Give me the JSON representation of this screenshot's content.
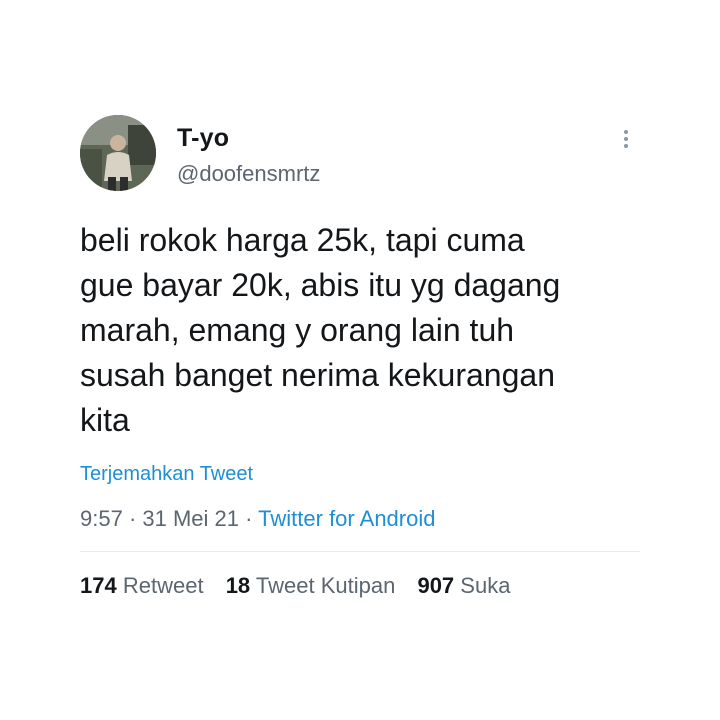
{
  "user": {
    "display_name": "T-yo",
    "handle": "@doofensmrtz"
  },
  "tweet": {
    "text": "beli rokok harga 25k, tapi cuma\ngue bayar 20k, abis itu yg dagang\nmarah, emang y orang lain tuh\nsusah banget nerima kekurangan\nkita",
    "translate_label": "Terjemahkan Tweet",
    "time": "9:57",
    "separator": " · ",
    "date": "31 Mei 21",
    "source": "Twitter for Android"
  },
  "stats": {
    "retweets_count": "174",
    "retweets_label": "Retweet",
    "quotes_count": "18",
    "quotes_label": "Tweet Kutipan",
    "likes_count": "907",
    "likes_label": "Suka"
  },
  "colors": {
    "link": "#1d8fd6",
    "secondary_text": "#5b6670",
    "primary_text": "#14171a"
  },
  "icons": {
    "more": "more-vertical-icon"
  }
}
